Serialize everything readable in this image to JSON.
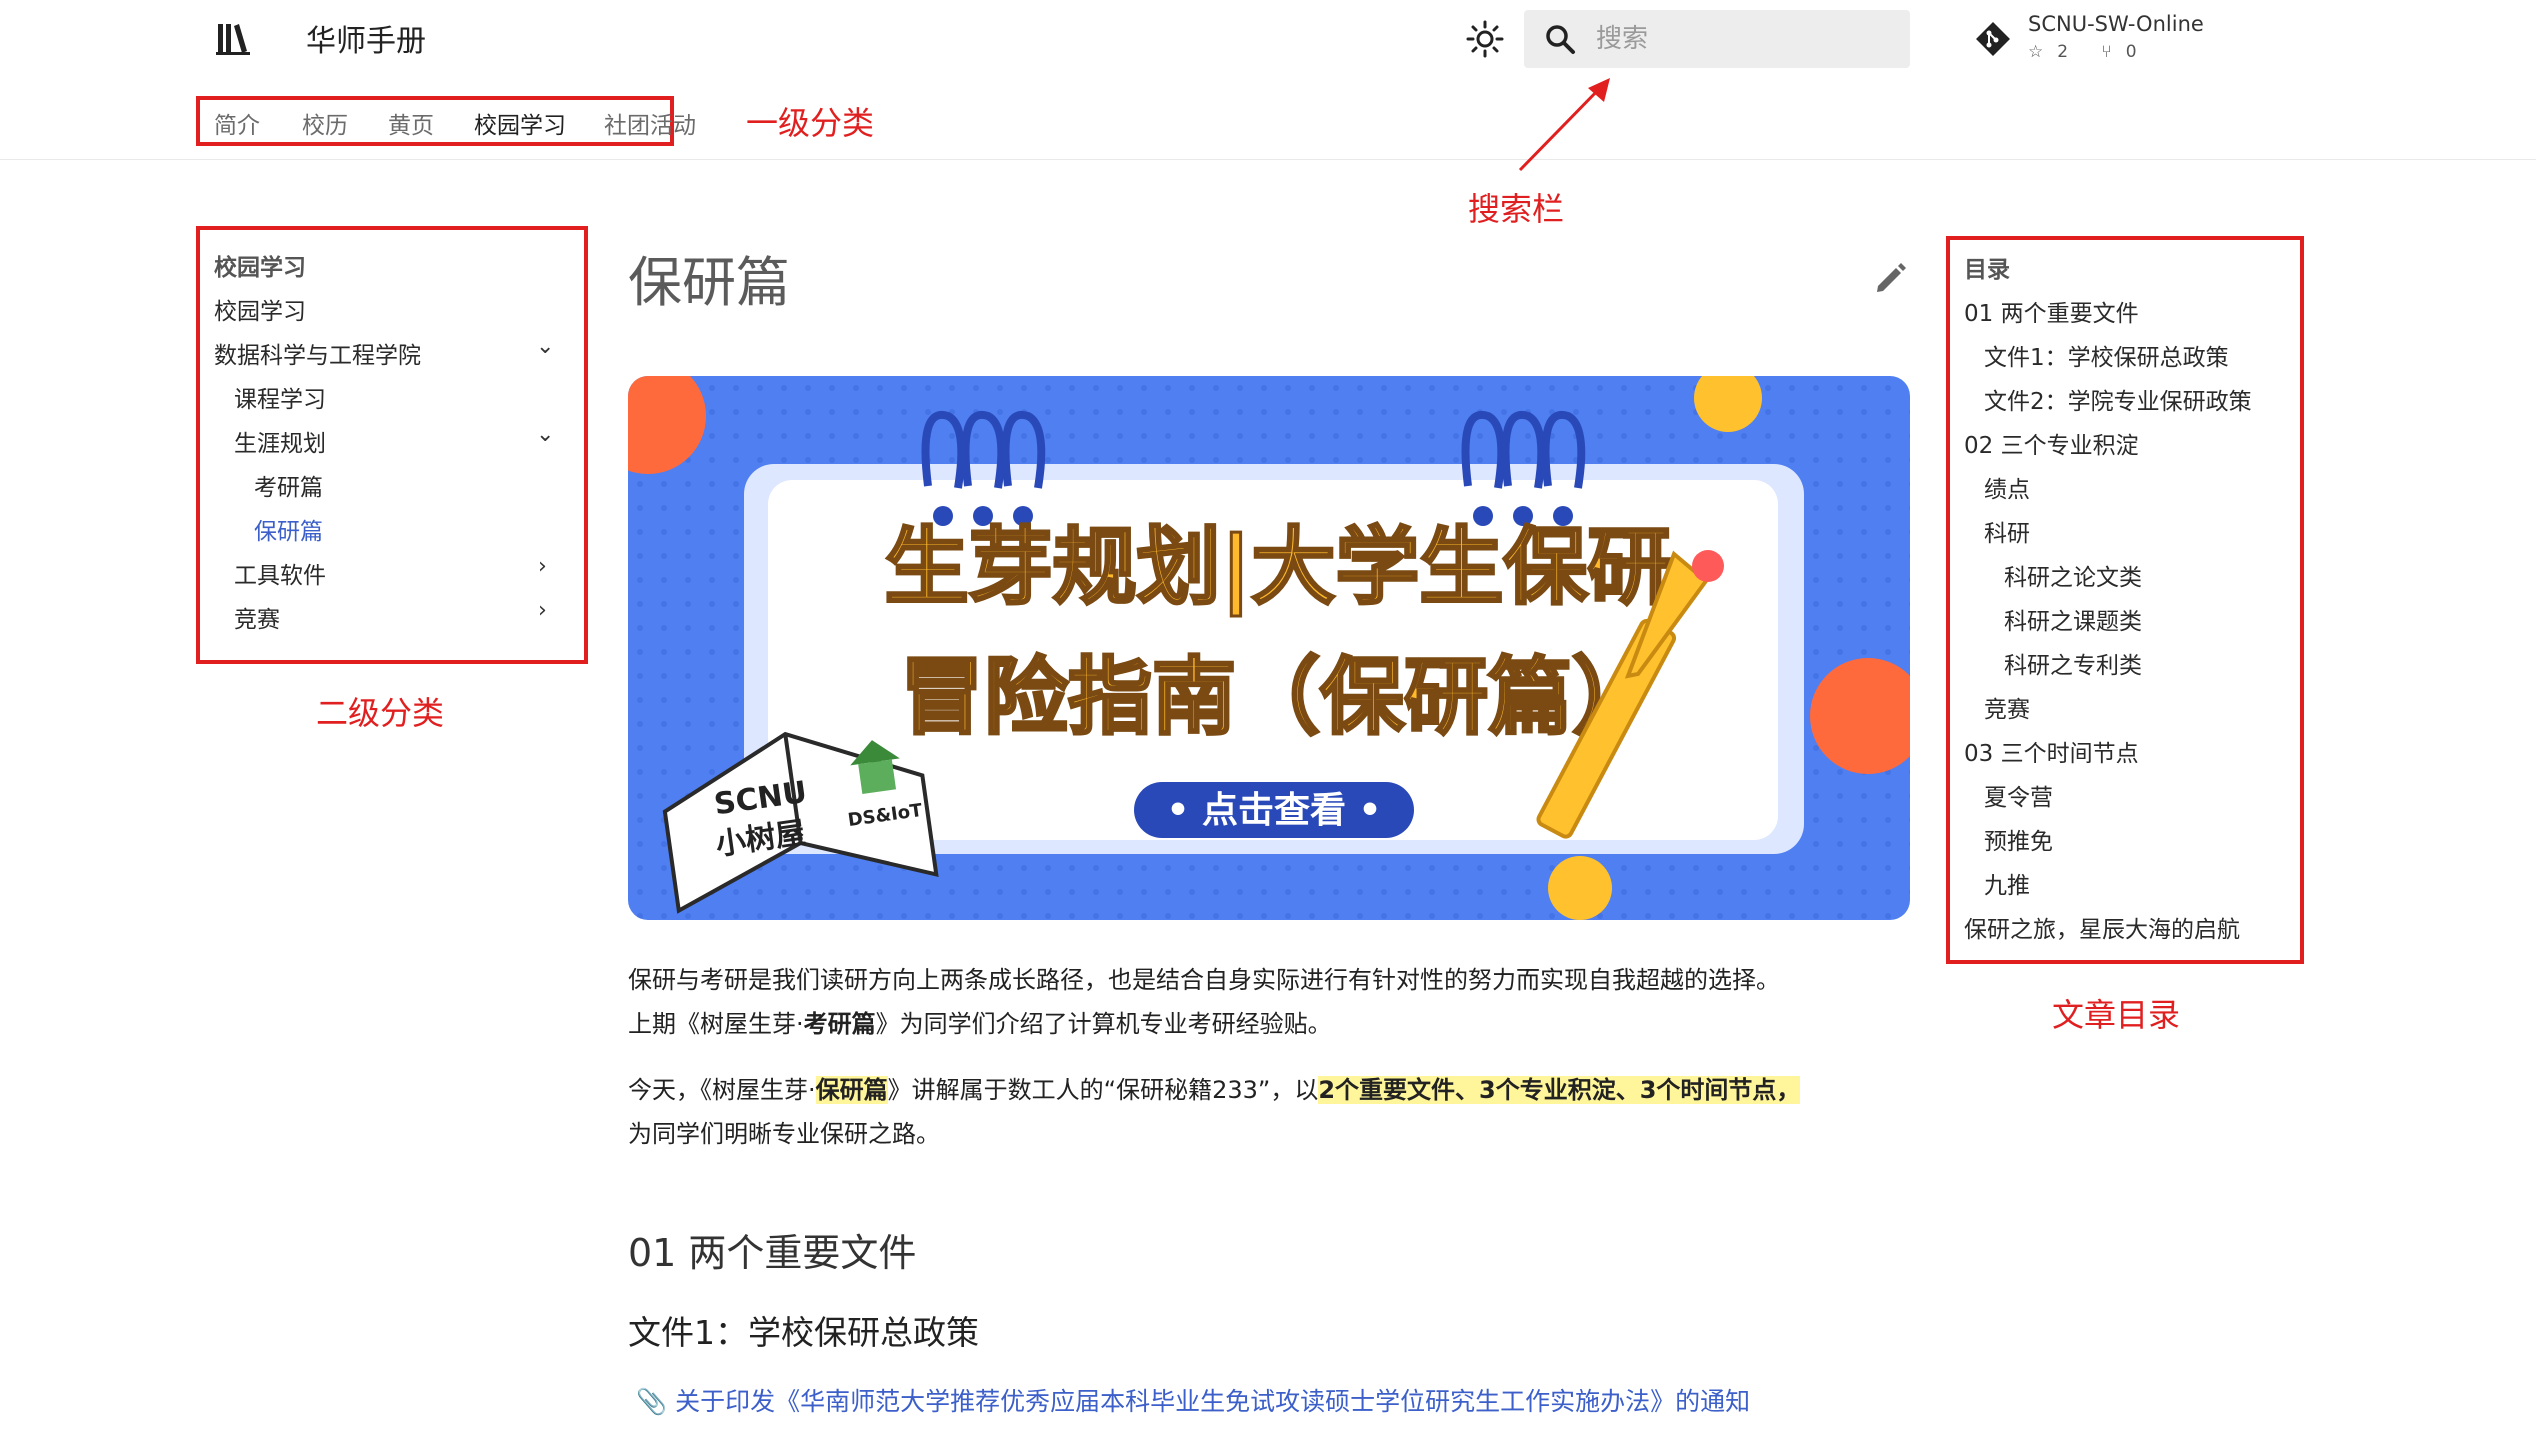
{
  "header": {
    "site_title": "华师手册",
    "search_placeholder": "搜索",
    "repo_name": "SCNU-SW-Online",
    "repo_stars": "2",
    "repo_forks": "0"
  },
  "tabs": [
    {
      "label": "简介"
    },
    {
      "label": "校历"
    },
    {
      "label": "黄页"
    },
    {
      "label": "校园学习"
    },
    {
      "label": "社团活动"
    }
  ],
  "annotations": {
    "tabs": "一级分类",
    "search": "搜索栏",
    "sidebar": "二级分类",
    "toc": "文章目录"
  },
  "sidebar": {
    "section_title": "校园学习",
    "items": [
      {
        "label": "校园学习"
      },
      {
        "label": "数据科学与工程学院",
        "chevron": "v"
      },
      {
        "label": "课程学习"
      },
      {
        "label": "生涯规划",
        "chevron": "v"
      },
      {
        "label": "考研篇"
      },
      {
        "label": "保研篇"
      },
      {
        "label": "工具软件",
        "chevron": ">"
      },
      {
        "label": "竞赛",
        "chevron": ">"
      }
    ]
  },
  "main": {
    "title": "保研篇",
    "banner": {
      "line1": "生芽规划|大学生保研",
      "line2": "冒险指南（保研篇）",
      "button": "• 点击查看 •",
      "book_line1": "SCNU",
      "book_line2": "小树屋",
      "book_tag": "DS&IoT"
    },
    "para1_line1": "保研与考研是我们读研方向上两条成长路径，也是结合自身实际进行有针对性的努力而实现自我超越的选择。",
    "para1_line2_a": "上期《树屋生芽·",
    "para1_line2_b": "考研篇",
    "para1_line2_c": "》为同学们介绍了计算机专业考研经验贴。",
    "para2_line1_a": "今天，《树屋生芽·",
    "para2_line1_b": "保研篇",
    "para2_line1_c": "》讲解属于数工人的“保研秘籍233”，以",
    "para2_line1_d": "2个重要文件、3个专业积淀、3个时间节点，",
    "para2_line2": "为同学们明晰专业保研之路。",
    "h2": "01 两个重要文件",
    "h3": "文件1：学校保研总政策",
    "link": "关于印发《华南师范大学推荐优秀应届本科毕业生免试攻读硕士学位研究生工作实施办法》的通知"
  },
  "toc": {
    "title": "目录",
    "items": [
      {
        "label": "01 两个重要文件",
        "level": 1
      },
      {
        "label": "文件1：学校保研总政策",
        "level": 2
      },
      {
        "label": "文件2：学院专业保研政策",
        "level": 2
      },
      {
        "label": "02 三个专业积淀",
        "level": 1
      },
      {
        "label": "绩点",
        "level": 2
      },
      {
        "label": "科研",
        "level": 2
      },
      {
        "label": "科研之论文类",
        "level": 3
      },
      {
        "label": "科研之课题类",
        "level": 3
      },
      {
        "label": "科研之专利类",
        "level": 3
      },
      {
        "label": "竞赛",
        "level": 2
      },
      {
        "label": "03 三个时间节点",
        "level": 1
      },
      {
        "label": "夏令营",
        "level": 2
      },
      {
        "label": "预推免",
        "level": 2
      },
      {
        "label": "九推",
        "level": 2
      },
      {
        "label": "保研之旅，星辰大海的启航",
        "level": 1
      }
    ]
  },
  "colors": {
    "annotation_red": "#e21f1f",
    "link_blue": "#3c5fc9",
    "highlight": "#fff59a",
    "banner_blue": "#4f7ff0"
  }
}
